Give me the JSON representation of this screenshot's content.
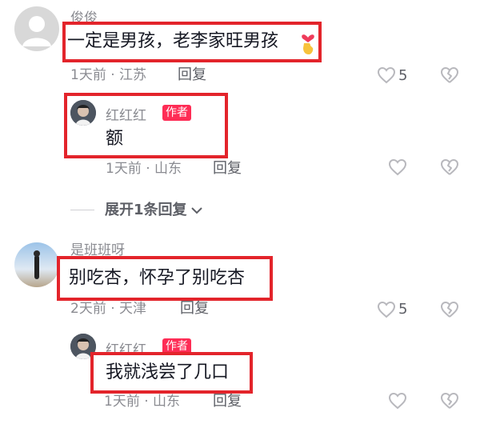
{
  "comments": [
    {
      "username": "俊俊",
      "text": "一定是男孩，老李家旺男孩",
      "time_location": "1天前 · 江苏",
      "reply_label": "回复",
      "likes": "5",
      "reply": {
        "username": "红红红",
        "badge": "作者",
        "text": "额",
        "time_location": "1天前 · 山东",
        "reply_label": "回复"
      },
      "expand_label": "展开1条回复"
    },
    {
      "username": "是班班呀",
      "text": "别吃杏，怀孕了别吃杏",
      "time_location": "2天前 · 天津",
      "reply_label": "回复",
      "likes": "5",
      "reply": {
        "username": "红红红",
        "badge": "作者",
        "text": "我就浅尝了几口",
        "time_location": "1天前 · 山东",
        "reply_label": "回复"
      }
    }
  ],
  "colors": {
    "highlight_box": "#e3242b",
    "author_badge": "#fe2c55"
  }
}
